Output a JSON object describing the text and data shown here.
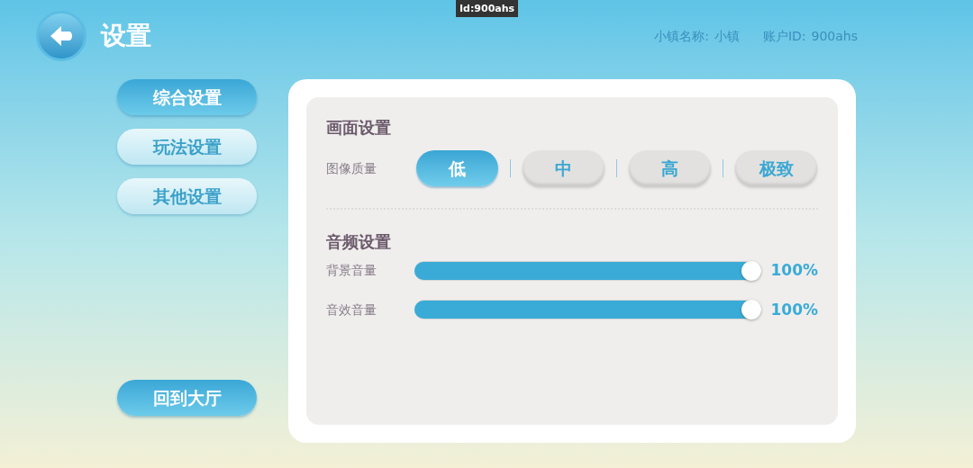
{
  "overlay_id": "Id:900ahs",
  "header": {
    "title": "设置",
    "town_label": "小镇名称:",
    "town_name": "小镇",
    "account_label": "账户ID:",
    "account_id": "900ahs"
  },
  "sidebar": {
    "items": [
      {
        "label": "综合设置",
        "selected": true
      },
      {
        "label": "玩法设置",
        "selected": false
      },
      {
        "label": "其他设置",
        "selected": false
      }
    ],
    "bottom_button": "回到大厅"
  },
  "graphics": {
    "title": "画面设置",
    "quality_label": "图像质量",
    "options": [
      {
        "label": "低",
        "selected": true
      },
      {
        "label": "中",
        "selected": false
      },
      {
        "label": "高",
        "selected": false
      },
      {
        "label": "极致",
        "selected": false
      }
    ]
  },
  "audio": {
    "title": "音频设置",
    "channels": [
      {
        "name": "背景音量",
        "level": 1,
        "reading": "100%"
      },
      {
        "name": "音效音量",
        "level": 1,
        "reading": "100%"
      }
    ]
  }
}
